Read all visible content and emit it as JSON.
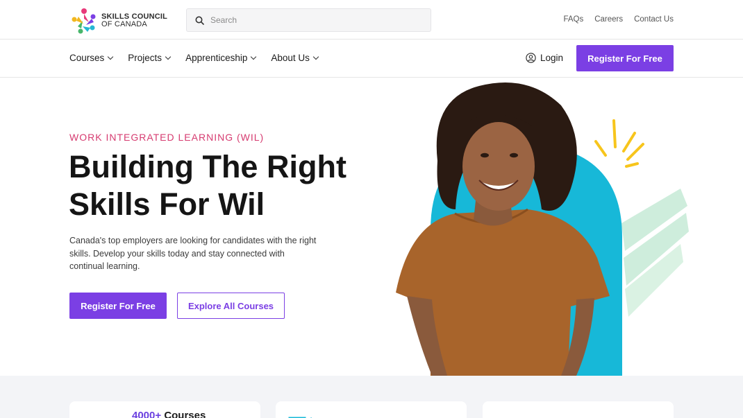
{
  "brand": {
    "line1": "SKILLS COUNCIL",
    "line2": "OF CANADA",
    "colors": [
      "#f2b71f",
      "#e8397a",
      "#25b7d3",
      "#7b3fe4",
      "#48b66b"
    ]
  },
  "search": {
    "placeholder": "Search",
    "icon": "search-icon"
  },
  "top_links": [
    "FAQs",
    "Careers",
    "Contact Us"
  ],
  "nav": {
    "items": [
      "Courses",
      "Projects",
      "Apprenticeship",
      "About Us"
    ],
    "login_label": "Login",
    "register_label": "Register For Free"
  },
  "hero": {
    "eyebrow": "WORK INTEGRATED LEARNING (WIL)",
    "headline_line1": "Building The Right",
    "headline_line2": "Skills For Wil",
    "description": "Canada's top employers are looking for candidates with the right skills. Develop your skills today and stay connected with continual learning.",
    "primary_cta": "Register For Free",
    "secondary_cta": "Explore All Courses"
  },
  "stats": [
    {
      "number": "4000+",
      "label": "Courses"
    }
  ],
  "colors": {
    "accent": "#7b3fe4",
    "eyebrow": "#d63b70",
    "teal": "#17b8d8",
    "yellow": "#f7c51c",
    "mint": "#c9ecd9"
  }
}
